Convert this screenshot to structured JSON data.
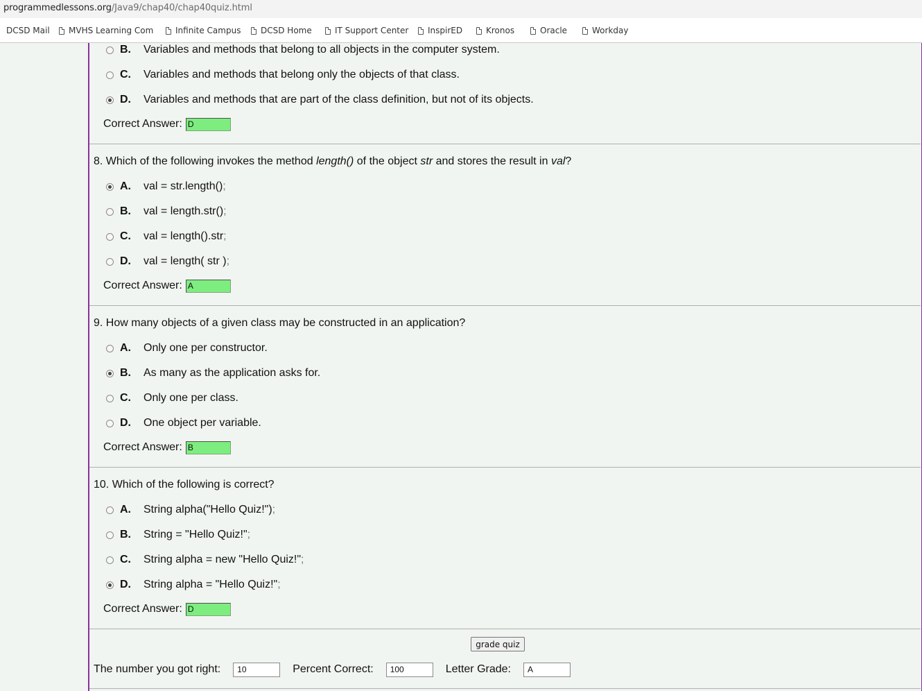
{
  "browser": {
    "url_domain": "programmedlessons.org",
    "url_path": "/Java9/chap40/chap40quiz.html",
    "bookmarks": [
      "DCSD Mail",
      "MVHS Learning Com",
      "Infinite Campus",
      "DCSD Home",
      "IT Support Center",
      "InspirED",
      "Kronos",
      "Oracle",
      "Workday"
    ]
  },
  "questions": [
    {
      "number": "",
      "parts": [],
      "options": [
        {
          "letter": "B.",
          "text": "Variables and methods that belong to all objects in the computer system.",
          "checked": false
        },
        {
          "letter": "C.",
          "text": "Variables and methods that belong only the objects of that class.",
          "checked": false
        },
        {
          "letter": "D.",
          "text": "Variables and methods that are part of the class definition, but not of its objects.",
          "checked": true
        }
      ],
      "answer_label": "Correct Answer:",
      "answer": "D"
    },
    {
      "number": "8.",
      "parts": [
        "Which of the following invokes the method ",
        "length()",
        " of the object ",
        "str",
        " and stores the result in ",
        "val",
        "?"
      ],
      "options": [
        {
          "letter": "A.",
          "text": "val = str.length() ",
          "punc": ";",
          "checked": true
        },
        {
          "letter": "B.",
          "text": "val = length.str() ",
          "punc": ";",
          "checked": false
        },
        {
          "letter": "C.",
          "text": "val = length().str ",
          "punc": ";",
          "checked": false
        },
        {
          "letter": "D.",
          "text": "val = length( str ) ",
          "punc": ";",
          "checked": false
        }
      ],
      "answer_label": "Correct Answer:",
      "answer": "A"
    },
    {
      "number": "9.",
      "parts": [
        "How many objects of a given class may be constructed in an application?"
      ],
      "options": [
        {
          "letter": "A.",
          "text": "Only one per constructor.",
          "checked": false
        },
        {
          "letter": "B.",
          "text": "As many as the application asks for.",
          "checked": true
        },
        {
          "letter": "C.",
          "text": "Only one per class.",
          "checked": false
        },
        {
          "letter": "D.",
          "text": "One object per variable.",
          "checked": false
        }
      ],
      "answer_label": "Correct Answer:",
      "answer": "B"
    },
    {
      "number": "10.",
      "parts": [
        "Which of the following is correct?"
      ],
      "options": [
        {
          "letter": "A.",
          "text": "String alpha(\"Hello Quiz!\") ",
          "punc": ";",
          "checked": false
        },
        {
          "letter": "B.",
          "text": "String = \"Hello Quiz!\" ",
          "punc": ";",
          "checked": false
        },
        {
          "letter": "C.",
          "text": "String alpha = new \"Hello Quiz!\" ",
          "punc": ";",
          "checked": false
        },
        {
          "letter": "D.",
          "text": "String alpha = \"Hello Quiz!\" ",
          "punc": ";",
          "checked": true
        }
      ],
      "answer_label": "Correct Answer:",
      "answer": "D"
    }
  ],
  "grading": {
    "button_label": "grade quiz",
    "right_label": "The number you got right:",
    "right_value": "10",
    "percent_label": "Percent Correct:",
    "percent_value": "100",
    "grade_label": "Letter Grade:",
    "grade_value": "A"
  }
}
